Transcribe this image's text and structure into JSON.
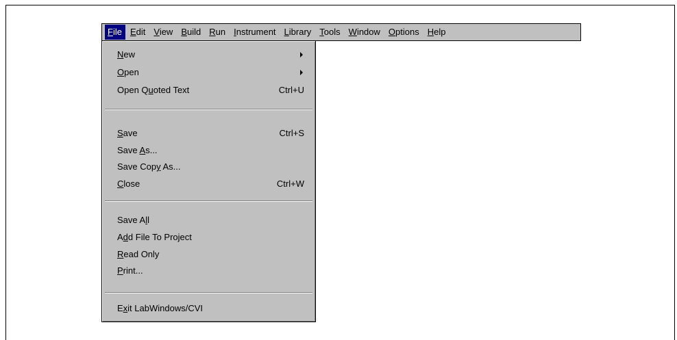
{
  "menubar": {
    "items": [
      {
        "pre": "",
        "key": "F",
        "post": "ile"
      },
      {
        "pre": "",
        "key": "E",
        "post": "dit"
      },
      {
        "pre": "",
        "key": "V",
        "post": "iew"
      },
      {
        "pre": "",
        "key": "B",
        "post": "uild"
      },
      {
        "pre": "",
        "key": "R",
        "post": "un"
      },
      {
        "pre": "",
        "key": "I",
        "post": "nstrument"
      },
      {
        "pre": "",
        "key": "L",
        "post": "ibrary"
      },
      {
        "pre": "",
        "key": "T",
        "post": "ools"
      },
      {
        "pre": "",
        "key": "W",
        "post": "indow"
      },
      {
        "pre": "",
        "key": "O",
        "post": "ptions"
      },
      {
        "pre": "",
        "key": "H",
        "post": "elp"
      }
    ]
  },
  "file_menu": {
    "items": [
      {
        "pre": "",
        "key": "N",
        "post": "ew",
        "shortcut": ""
      },
      {
        "pre": "",
        "key": "O",
        "post": "pen",
        "shortcut": ""
      },
      {
        "pre": "Open Q",
        "key": "u",
        "post": "oted Text",
        "shortcut": "Ctrl+U"
      },
      {
        "pre": "",
        "key": "S",
        "post": "ave",
        "shortcut": "Ctrl+S"
      },
      {
        "pre": "Save ",
        "key": "A",
        "post": "s...",
        "shortcut": ""
      },
      {
        "pre": "Save Cop",
        "key": "y",
        "post": " As...",
        "shortcut": ""
      },
      {
        "pre": "",
        "key": "C",
        "post": "lose",
        "shortcut": "Ctrl+W"
      },
      {
        "pre": "Save A",
        "key": "l",
        "post": "l",
        "shortcut": ""
      },
      {
        "pre": "A",
        "key": "d",
        "post": "d File To Project",
        "shortcut": ""
      },
      {
        "pre": "",
        "key": "R",
        "post": "ead Only",
        "shortcut": ""
      },
      {
        "pre": "",
        "key": "P",
        "post": "rint...",
        "shortcut": ""
      },
      {
        "pre": "E",
        "key": "x",
        "post": "it LabWindows/CVI",
        "shortcut": ""
      }
    ]
  }
}
